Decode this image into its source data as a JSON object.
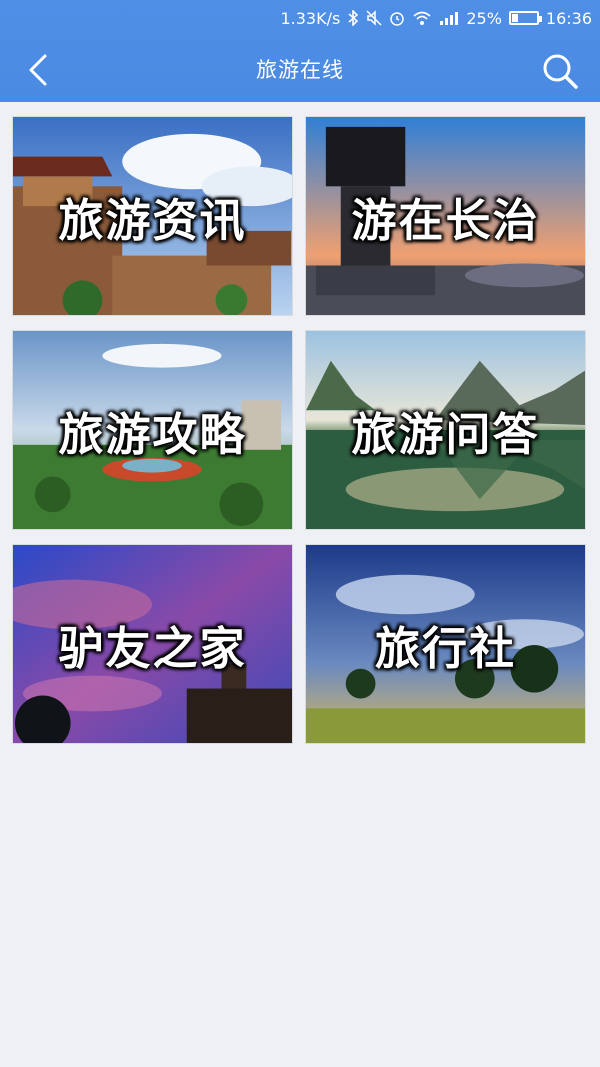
{
  "status_bar": {
    "speed": "1.33K/s",
    "battery": "25%",
    "battery_level": 0.25,
    "time": "16:36",
    "icons": [
      "bluetooth-icon",
      "mute-icon",
      "alarm-icon",
      "wifi-icon",
      "signal-icon",
      "battery-icon"
    ]
  },
  "header": {
    "title": "旅游在线",
    "back_icon": "chevron-left-icon",
    "search_icon": "search-icon"
  },
  "colors": {
    "header_bg": "#4a8ae2",
    "page_bg": "#eef0f4",
    "label_text": "#ffffff"
  },
  "tiles": [
    {
      "label": "旅游资讯",
      "scene": "ancient city tower under blue sky"
    },
    {
      "label": "游在长治",
      "scene": "bronze vessel monument plaza at dusk"
    },
    {
      "label": "旅游攻略",
      "scene": "aerial view of city park with fountain"
    },
    {
      "label": "旅游问答",
      "scene": "mountains reflected in lake"
    },
    {
      "label": "驴友之家",
      "scene": "purple evening sky with tower silhouette"
    },
    {
      "label": "旅行社",
      "scene": "trees on grassland under dramatic sky"
    }
  ]
}
